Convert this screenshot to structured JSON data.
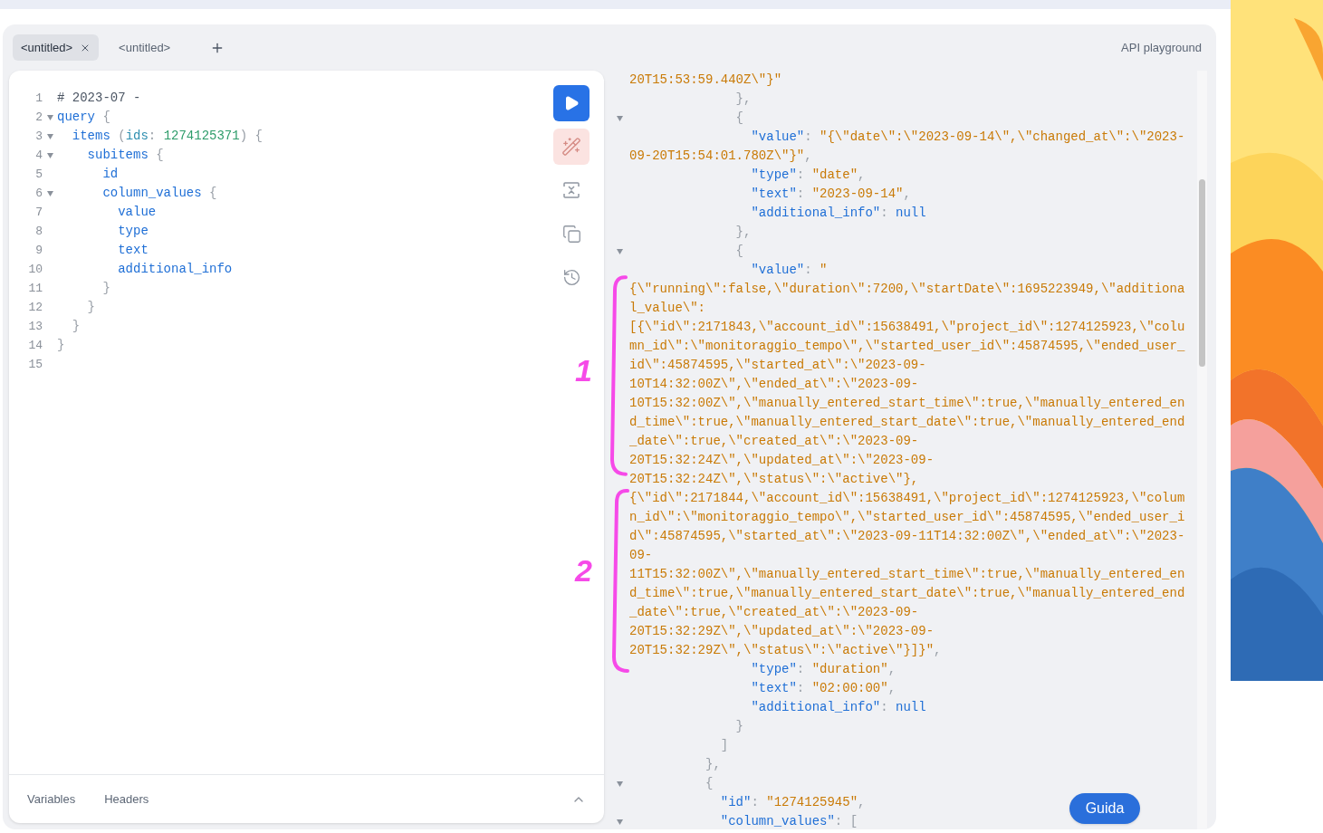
{
  "header": {
    "tabs": [
      {
        "label": "<untitled>",
        "selected": true,
        "closable": true
      },
      {
        "label": "<untitled>",
        "selected": false,
        "closable": false
      }
    ],
    "title": "API playground"
  },
  "editor": {
    "lines": [
      {
        "number": "1",
        "fold": false,
        "tokens": [
          {
            "kind": "comment",
            "text": "# 2023-07 -"
          }
        ]
      },
      {
        "number": "2",
        "fold": true,
        "tokens": [
          {
            "kind": "key",
            "text": "query"
          },
          {
            "kind": "punct",
            "text": " {"
          }
        ]
      },
      {
        "number": "3",
        "fold": true,
        "tokens": [
          {
            "kind": "key",
            "text": "  items"
          },
          {
            "kind": "punct",
            "text": " ("
          },
          {
            "kind": "arg",
            "text": "ids"
          },
          {
            "kind": "punct",
            "text": ": "
          },
          {
            "kind": "number",
            "text": "1274125371"
          },
          {
            "kind": "punct",
            "text": ") {"
          }
        ]
      },
      {
        "number": "4",
        "fold": true,
        "tokens": [
          {
            "kind": "key",
            "text": "    subitems"
          },
          {
            "kind": "punct",
            "text": " {"
          }
        ]
      },
      {
        "number": "5",
        "fold": false,
        "tokens": [
          {
            "kind": "key",
            "text": "      id"
          }
        ]
      },
      {
        "number": "6",
        "fold": true,
        "tokens": [
          {
            "kind": "key",
            "text": "      column_values"
          },
          {
            "kind": "punct",
            "text": " {"
          }
        ]
      },
      {
        "number": "7",
        "fold": false,
        "tokens": [
          {
            "kind": "key",
            "text": "        value"
          }
        ]
      },
      {
        "number": "8",
        "fold": false,
        "tokens": [
          {
            "kind": "key",
            "text": "        type"
          }
        ]
      },
      {
        "number": "9",
        "fold": false,
        "tokens": [
          {
            "kind": "key",
            "text": "        text"
          }
        ]
      },
      {
        "number": "10",
        "fold": false,
        "tokens": [
          {
            "kind": "key",
            "text": "        additional_info"
          }
        ]
      },
      {
        "number": "11",
        "fold": false,
        "tokens": [
          {
            "kind": "punct",
            "text": "      }"
          }
        ]
      },
      {
        "number": "12",
        "fold": false,
        "tokens": [
          {
            "kind": "punct",
            "text": "    }"
          }
        ]
      },
      {
        "number": "13",
        "fold": false,
        "tokens": [
          {
            "kind": "punct",
            "text": "  }"
          }
        ]
      },
      {
        "number": "14",
        "fold": false,
        "tokens": [
          {
            "kind": "punct",
            "text": "}"
          }
        ]
      },
      {
        "number": "15",
        "fold": false
      }
    ]
  },
  "toolbar": [
    {
      "kind": "run"
    },
    {
      "kind": "prettify"
    },
    {
      "kind": "merge"
    },
    {
      "kind": "copy"
    },
    {
      "kind": "history"
    }
  ],
  "bottom_tabs": [
    "Variables",
    "Headers"
  ],
  "result": {
    "lines": [
      {
        "fold": false,
        "tokens": [
          {
            "kind": "string",
            "text": "20T15:53:59.440Z\\\"}\""
          }
        ]
      },
      {
        "fold": false,
        "tokens": [
          {
            "kind": "punct",
            "text": "              },"
          }
        ]
      },
      {
        "fold": true,
        "tokens": [
          {
            "kind": "punct",
            "text": "              {"
          }
        ]
      },
      {
        "fold": false,
        "tokens": [
          {
            "kind": "key",
            "text": "                \"value\""
          },
          {
            "kind": "punct",
            "text": ": "
          },
          {
            "kind": "string",
            "text": "\"{\\\"date\\\":\\\"2023-09-14\\\",\\\"changed_at\\\":\\\"2023-"
          }
        ]
      },
      {
        "fold": false,
        "tokens": [
          {
            "kind": "string",
            "text": "09-20T15:54:01.780Z\\\"}\""
          },
          {
            "kind": "punct",
            "text": ","
          }
        ]
      },
      {
        "fold": false,
        "tokens": [
          {
            "kind": "key",
            "text": "                \"type\""
          },
          {
            "kind": "punct",
            "text": ": "
          },
          {
            "kind": "string",
            "text": "\"date\""
          },
          {
            "kind": "punct",
            "text": ","
          }
        ]
      },
      {
        "fold": false,
        "tokens": [
          {
            "kind": "key",
            "text": "                \"text\""
          },
          {
            "kind": "punct",
            "text": ": "
          },
          {
            "kind": "string",
            "text": "\"2023-09-14\""
          },
          {
            "kind": "punct",
            "text": ","
          }
        ]
      },
      {
        "fold": false,
        "tokens": [
          {
            "kind": "key",
            "text": "                \"additional_info\""
          },
          {
            "kind": "punct",
            "text": ": "
          },
          {
            "kind": "null",
            "text": "null"
          }
        ]
      },
      {
        "fold": false,
        "tokens": [
          {
            "kind": "punct",
            "text": "              },"
          }
        ]
      },
      {
        "fold": true,
        "tokens": [
          {
            "kind": "punct",
            "text": "              {"
          }
        ]
      },
      {
        "fold": false,
        "tokens": [
          {
            "kind": "key",
            "text": "                \"value\""
          },
          {
            "kind": "punct",
            "text": ": "
          },
          {
            "kind": "string",
            "text": "\""
          }
        ]
      },
      {
        "fold": false,
        "tokens": [
          {
            "kind": "string",
            "text": "{\\\"running\\\":false,\\\"duration\\\":7200,\\\"startDate\\\":1695223949,\\\"additiona"
          }
        ]
      },
      {
        "fold": false,
        "tokens": [
          {
            "kind": "string",
            "text": "l_value\\\":"
          }
        ]
      },
      {
        "fold": false,
        "tokens": [
          {
            "kind": "string",
            "text": "[{\\\"id\\\":2171843,\\\"account_id\\\":15638491,\\\"project_id\\\":1274125923,\\\"colu"
          }
        ]
      },
      {
        "fold": false,
        "tokens": [
          {
            "kind": "string",
            "text": "mn_id\\\":\\\"monitoraggio_tempo\\\",\\\"started_user_id\\\":45874595,\\\"ended_user_"
          }
        ]
      },
      {
        "fold": false,
        "tokens": [
          {
            "kind": "string",
            "text": "id\\\":45874595,\\\"started_at\\\":\\\"2023-09-"
          }
        ]
      },
      {
        "fold": false,
        "tokens": [
          {
            "kind": "string",
            "text": "10T14:32:00Z\\\",\\\"ended_at\\\":\\\"2023-09-"
          }
        ]
      },
      {
        "fold": false,
        "tokens": [
          {
            "kind": "string",
            "text": "10T15:32:00Z\\\",\\\"manually_entered_start_time\\\":true,\\\"manually_entered_en"
          }
        ]
      },
      {
        "fold": false,
        "tokens": [
          {
            "kind": "string",
            "text": "d_time\\\":true,\\\"manually_entered_start_date\\\":true,\\\"manually_entered_end"
          }
        ]
      },
      {
        "fold": false,
        "tokens": [
          {
            "kind": "string",
            "text": "_date\\\":true,\\\"created_at\\\":\\\"2023-09-"
          }
        ]
      },
      {
        "fold": false,
        "tokens": [
          {
            "kind": "string",
            "text": "20T15:32:24Z\\\",\\\"updated_at\\\":\\\"2023-09-"
          }
        ]
      },
      {
        "fold": false,
        "tokens": [
          {
            "kind": "string",
            "text": "20T15:32:24Z\\\",\\\"status\\\":\\\"active\\\"},"
          }
        ]
      },
      {
        "fold": false,
        "tokens": [
          {
            "kind": "string",
            "text": "{\\\"id\\\":2171844,\\\"account_id\\\":15638491,\\\"project_id\\\":1274125923,\\\"colum"
          }
        ]
      },
      {
        "fold": false,
        "tokens": [
          {
            "kind": "string",
            "text": "n_id\\\":\\\"monitoraggio_tempo\\\",\\\"started_user_id\\\":45874595,\\\"ended_user_i"
          }
        ]
      },
      {
        "fold": false,
        "tokens": [
          {
            "kind": "string",
            "text": "d\\\":45874595,\\\"started_at\\\":\\\"2023-09-11T14:32:00Z\\\",\\\"ended_at\\\":\\\"2023-"
          }
        ]
      },
      {
        "fold": false,
        "tokens": [
          {
            "kind": "string",
            "text": "09-"
          }
        ]
      },
      {
        "fold": false,
        "tokens": [
          {
            "kind": "string",
            "text": "11T15:32:00Z\\\",\\\"manually_entered_start_time\\\":true,\\\"manually_entered_en"
          }
        ]
      },
      {
        "fold": false,
        "tokens": [
          {
            "kind": "string",
            "text": "d_time\\\":true,\\\"manually_entered_start_date\\\":true,\\\"manually_entered_end"
          }
        ]
      },
      {
        "fold": false,
        "tokens": [
          {
            "kind": "string",
            "text": "_date\\\":true,\\\"created_at\\\":\\\"2023-09-"
          }
        ]
      },
      {
        "fold": false,
        "tokens": [
          {
            "kind": "string",
            "text": "20T15:32:29Z\\\",\\\"updated_at\\\":\\\"2023-09-"
          }
        ]
      },
      {
        "fold": false,
        "tokens": [
          {
            "kind": "string",
            "text": "20T15:32:29Z\\\",\\\"status\\\":\\\"active\\\"}]}\""
          },
          {
            "kind": "punct",
            "text": ","
          }
        ]
      },
      {
        "fold": false,
        "tokens": [
          {
            "kind": "key",
            "text": "                \"type\""
          },
          {
            "kind": "punct",
            "text": ": "
          },
          {
            "kind": "string",
            "text": "\"duration\""
          },
          {
            "kind": "punct",
            "text": ","
          }
        ]
      },
      {
        "fold": false,
        "tokens": [
          {
            "kind": "key",
            "text": "                \"text\""
          },
          {
            "kind": "punct",
            "text": ": "
          },
          {
            "kind": "string",
            "text": "\"02:00:00\""
          },
          {
            "kind": "punct",
            "text": ","
          }
        ]
      },
      {
        "fold": false,
        "tokens": [
          {
            "kind": "key",
            "text": "                \"additional_info\""
          },
          {
            "kind": "punct",
            "text": ": "
          },
          {
            "kind": "null",
            "text": "null"
          }
        ]
      },
      {
        "fold": false,
        "tokens": [
          {
            "kind": "punct",
            "text": "              }"
          }
        ]
      },
      {
        "fold": false,
        "tokens": [
          {
            "kind": "punct",
            "text": "            ]"
          }
        ]
      },
      {
        "fold": false,
        "tokens": [
          {
            "kind": "punct",
            "text": "          },"
          }
        ]
      },
      {
        "fold": true,
        "tokens": [
          {
            "kind": "punct",
            "text": "          {"
          }
        ]
      },
      {
        "fold": false,
        "tokens": [
          {
            "kind": "key",
            "text": "            \"id\""
          },
          {
            "kind": "punct",
            "text": ": "
          },
          {
            "kind": "string",
            "text": "\"1274125945\""
          },
          {
            "kind": "punct",
            "text": ","
          }
        ]
      },
      {
        "fold": true,
        "tokens": [
          {
            "kind": "key",
            "text": "            \"column_values\""
          },
          {
            "kind": "punct",
            "text": ": ["
          }
        ]
      }
    ]
  },
  "annotations": [
    {
      "label": "1"
    },
    {
      "label": "2"
    }
  ],
  "help_button": "Guida"
}
